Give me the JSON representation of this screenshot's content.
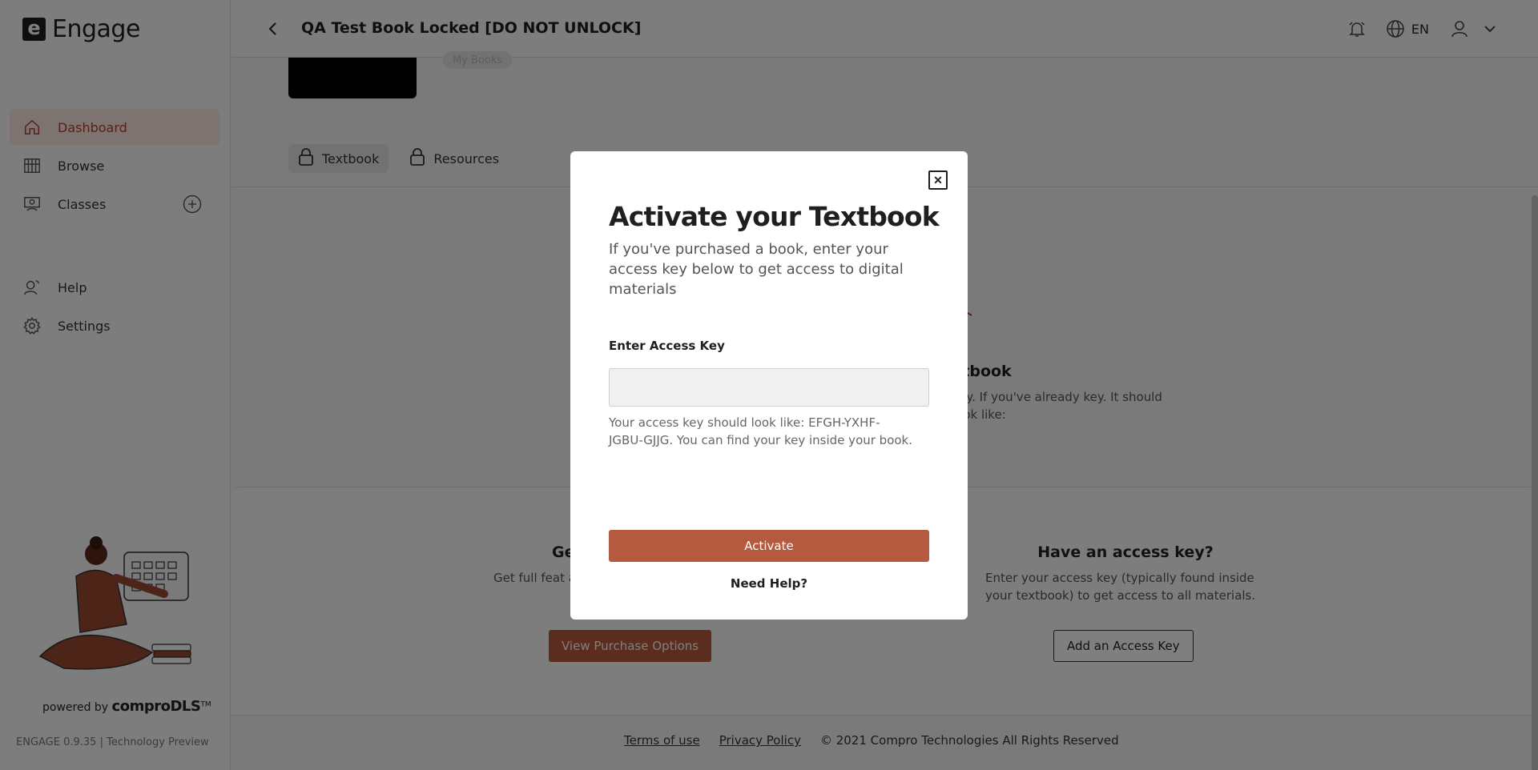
{
  "brand": {
    "name": "Engage",
    "mark": "e"
  },
  "sidebar": {
    "items": [
      {
        "label": "Dashboard",
        "icon": "home-icon",
        "active": true
      },
      {
        "label": "Browse",
        "icon": "library-icon"
      },
      {
        "label": "Classes",
        "icon": "classes-icon"
      },
      {
        "label": "Help",
        "icon": "help-icon"
      },
      {
        "label": "Settings",
        "icon": "gear-icon"
      }
    ],
    "powered_by_prefix": "powered by",
    "powered_by_brand": "comproDLS",
    "powered_by_tm": "TM",
    "version": "ENGAGE 0.9.35 | Technology Preview"
  },
  "header": {
    "title": "QA Test Book Locked [DO NOT UNLOCK]",
    "language": "EN"
  },
  "book": {
    "chip": "My Books",
    "tabs": [
      {
        "label": "Textbook",
        "active": true
      },
      {
        "label": "Resources"
      }
    ],
    "locked_title": "xtbook",
    "locked_desc": "key. If you've already key. It should look like:"
  },
  "cards": {
    "purchase_title": "Ge",
    "purchase_desc": "Get full feat and resource",
    "purchase_button": "View Purchase Options",
    "key_title": "Have an access key?",
    "key_desc": "Enter your access key (typically found inside your textbook) to get access to all materials.",
    "key_button": "Add an Access Key"
  },
  "footer": {
    "terms": "Terms of use",
    "privacy": "Privacy Policy",
    "copyright": "© 2021 Compro Technologies All Rights Reserved"
  },
  "modal": {
    "close_glyph": "✕",
    "title": "Activate your Textbook",
    "subtitle": "If you've purchased a book, enter your access key below to get access to digital materials",
    "field_label": "Enter Access Key",
    "field_value": "",
    "hint": "Your access key should look like: EFGH-YXHF-JGBU-GJJG. You can find your key inside your book.",
    "activate_button": "Activate",
    "need_help": "Need Help?"
  },
  "colors": {
    "accent": "#b65a3f",
    "active_nav_bg": "#fbe9e4",
    "active_nav_text": "#a8432b"
  }
}
